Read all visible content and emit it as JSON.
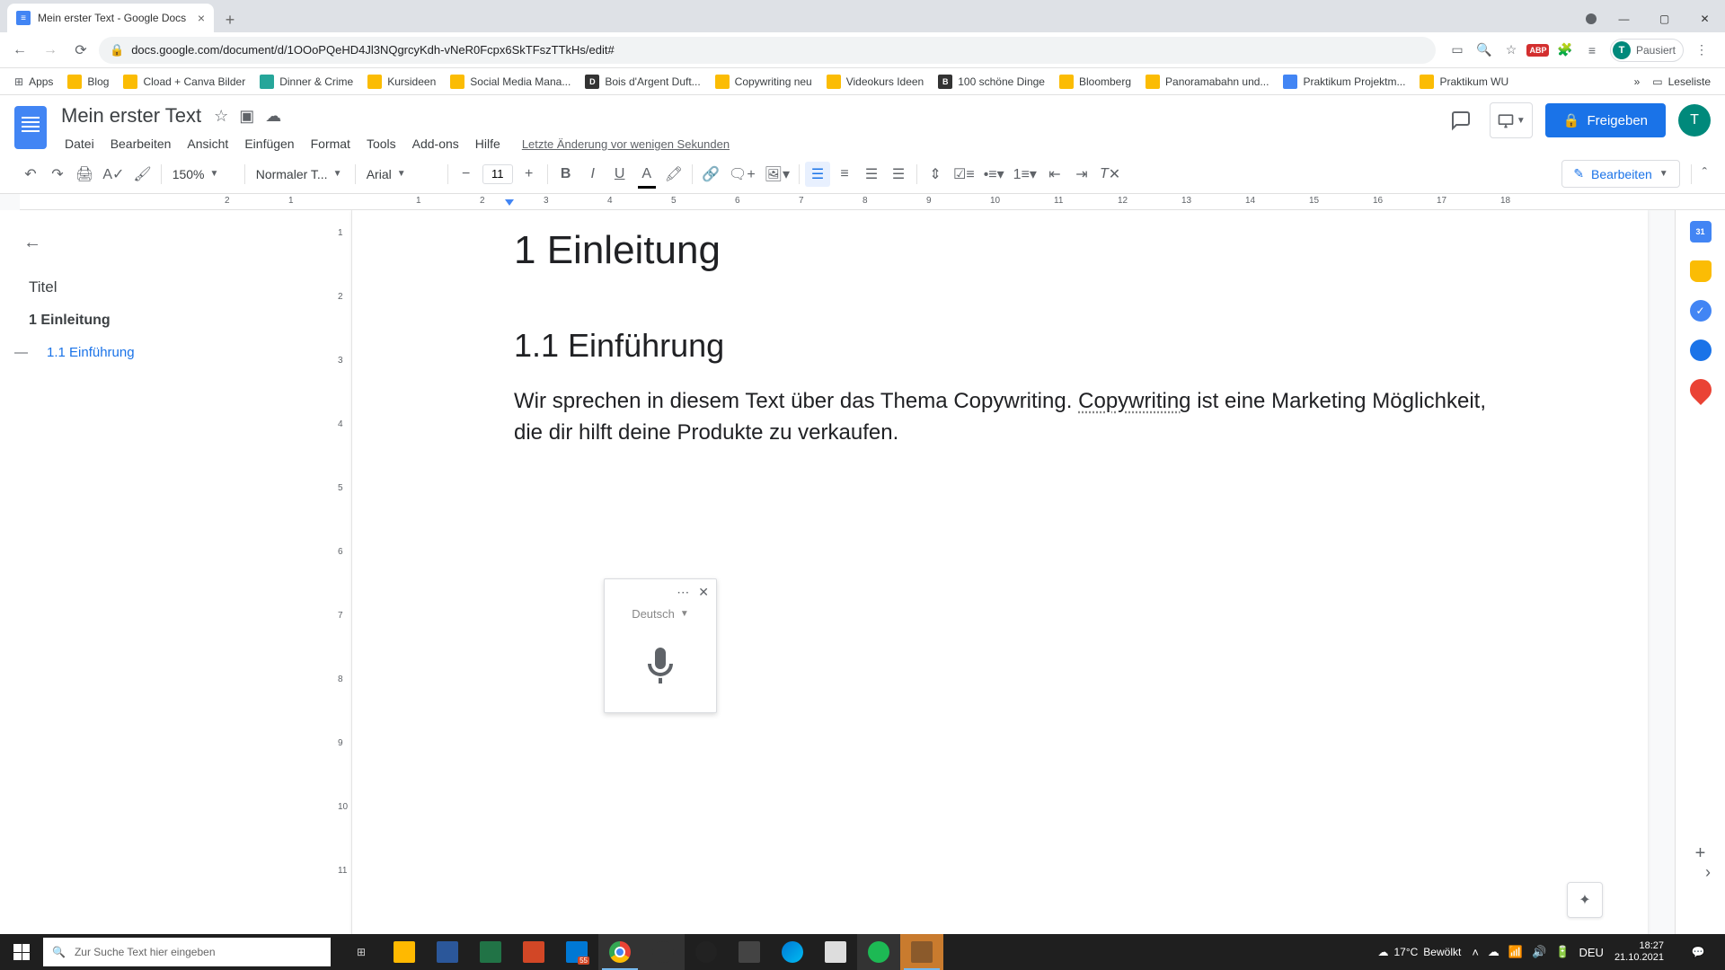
{
  "browser": {
    "tab_title": "Mein erster Text - Google Docs",
    "url": "docs.google.com/document/d/1OOoPQeHD4Jl3NQgrcyKdh-vNeR0Fcpx6SkTFszTTkHs/edit#",
    "profile_status": "Pausiert",
    "profile_initial": "T",
    "bookmarks": [
      "Apps",
      "Blog",
      "Cload + Canva Bilder",
      "Dinner & Crime",
      "Kursideen",
      "Social Media Mana...",
      "Bois d'Argent Duft...",
      "Copywriting neu",
      "Videokurs Ideen",
      "100 schöne Dinge",
      "Bloomberg",
      "Panoramabahn und...",
      "Praktikum Projektm...",
      "Praktikum WU"
    ],
    "reading_list": "Leseliste"
  },
  "docs": {
    "title": "Mein erster Text",
    "menus": [
      "Datei",
      "Bearbeiten",
      "Ansicht",
      "Einfügen",
      "Format",
      "Tools",
      "Add-ons",
      "Hilfe"
    ],
    "last_edit": "Letzte Änderung vor wenigen Sekunden",
    "share_label": "Freigeben",
    "avatar_initial": "T"
  },
  "toolbar": {
    "zoom": "150%",
    "style": "Normaler T...",
    "font": "Arial",
    "font_size": "11",
    "edit_mode": "Bearbeiten"
  },
  "ruler": {
    "marks": [
      "2",
      "1",
      "",
      "1",
      "2",
      "3",
      "4",
      "5",
      "6",
      "7",
      "8",
      "9",
      "10",
      "11",
      "12",
      "13",
      "14",
      "15",
      "16",
      "17",
      "18"
    ]
  },
  "v_ruler": [
    "1",
    "2",
    "3",
    "4",
    "5",
    "6",
    "7",
    "8",
    "9",
    "10",
    "11"
  ],
  "outline": {
    "title": "Titel",
    "h1": "1 Einleitung",
    "h2": "1.1 Einführung"
  },
  "document": {
    "h1": "1 Einleitung",
    "h2": "1.1 Einführung",
    "p_before": "Wir sprechen in diesem Text über das Thema Copywriting. ",
    "p_spell": "Copywriting",
    "p_after": " ist eine Marketing Möglichkeit, die dir hilft deine Produkte zu verkaufen."
  },
  "voice": {
    "language": "Deutsch"
  },
  "taskbar": {
    "search_placeholder": "Zur Suche Text hier eingeben",
    "weather_temp": "17°C",
    "weather_desc": "Bewölkt",
    "lang": "DEU",
    "time": "18:27",
    "date": "21.10.2021"
  }
}
